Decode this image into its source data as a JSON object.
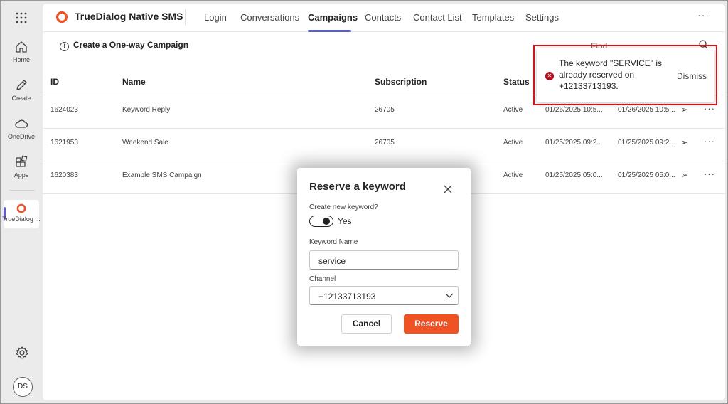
{
  "rail": {
    "items": [
      {
        "label": "Home",
        "icon": "home-icon"
      },
      {
        "label": "Create",
        "icon": "pencil-icon"
      },
      {
        "label": "OneDrive",
        "icon": "cloud-icon"
      },
      {
        "label": "Apps",
        "icon": "apps-icon"
      },
      {
        "label": "TrueDialog ...",
        "icon": "truedialog-logo-icon"
      }
    ],
    "avatar_initials": "DS"
  },
  "app": {
    "name": "TrueDialog Native SMS",
    "brand_color": "#f05323",
    "tabs": [
      {
        "label": "Login",
        "active": false
      },
      {
        "label": "Conversations",
        "active": false
      },
      {
        "label": "Campaigns",
        "active": true
      },
      {
        "label": "Contacts",
        "active": false
      },
      {
        "label": "Contact List",
        "active": false
      },
      {
        "label": "Templates",
        "active": false
      },
      {
        "label": "Settings",
        "active": false
      }
    ],
    "more": "···"
  },
  "commands": {
    "create_label": "Create a One-way Campaign",
    "find_placeholder": "Find"
  },
  "table": {
    "headers": [
      "ID",
      "Name",
      "Subscription",
      "Status"
    ],
    "rows": [
      {
        "id": "1624023",
        "name": "Keyword Reply",
        "subscription": "26705",
        "status": "Active",
        "created": "01/26/2025 10:5...",
        "updated": "01/26/2025 10:5..."
      },
      {
        "id": "1621953",
        "name": "Weekend Sale",
        "subscription": "26705",
        "status": "Active",
        "created": "01/25/2025 09:2...",
        "updated": "01/25/2025 09:2..."
      },
      {
        "id": "1620383",
        "name": "Example SMS Campaign",
        "subscription": "",
        "status": "Active",
        "created": "01/25/2025 05:0...",
        "updated": "01/25/2025 05:0..."
      }
    ],
    "row_send": "➢",
    "row_more": "···"
  },
  "notification": {
    "message": "The keyword \"SERVICE\" is already reserved on +12133713193.",
    "dismiss_label": "Dismiss",
    "error_color": "#b10e1c"
  },
  "dialog": {
    "title": "Reserve a keyword",
    "create_new_label": "Create new keyword?",
    "toggle_text": "Yes",
    "toggle_on": true,
    "keyword_label": "Keyword Name",
    "keyword_value": "service",
    "channel_label": "Channel",
    "channel_value": "+12133713193",
    "cancel_label": "Cancel",
    "reserve_label": "Reserve"
  }
}
